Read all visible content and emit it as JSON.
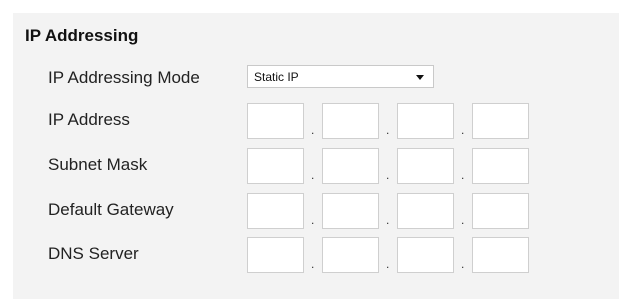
{
  "section": {
    "title": "IP Addressing"
  },
  "mode": {
    "label": "IP Addressing Mode",
    "selected": "Static IP"
  },
  "fields": [
    {
      "label": "IP Address",
      "octets": [
        "",
        "",
        "",
        ""
      ]
    },
    {
      "label": "Subnet Mask",
      "octets": [
        "",
        "",
        "",
        ""
      ]
    },
    {
      "label": "Default Gateway",
      "octets": [
        "",
        "",
        "",
        ""
      ]
    },
    {
      "label": "DNS Server",
      "octets": [
        "",
        "",
        "",
        ""
      ]
    }
  ],
  "separator": "."
}
